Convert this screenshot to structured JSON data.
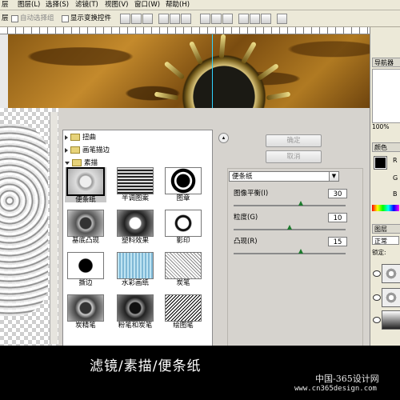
{
  "menu": [
    "层",
    "图层(L)",
    "选择(S)",
    "滤镜(T)",
    "视图(V)",
    "窗口(W)",
    "帮助(H)"
  ],
  "options": {
    "layer_label": "层",
    "auto_select_group": "自动选择组",
    "show_transform": "显示变换控件"
  },
  "panels": {
    "navigator_tab": "导航器",
    "zoom": "100%",
    "color_tab": "颜色",
    "color_channels": [
      "R",
      "G",
      "B"
    ],
    "layers_tab": "图层",
    "blend_mode": "正常",
    "lock_label": "锁定:"
  },
  "filter_gallery": {
    "categories": [
      {
        "label": "扭曲",
        "expanded": false
      },
      {
        "label": "画笔描边",
        "expanded": false
      },
      {
        "label": "素描",
        "expanded": true
      }
    ],
    "filters": [
      {
        "label": "便条纸",
        "selected": true
      },
      {
        "label": "半调图案"
      },
      {
        "label": "图章"
      },
      {
        "label": "基底凸现"
      },
      {
        "label": "塑料效果"
      },
      {
        "label": "影印"
      },
      {
        "label": "撕边"
      },
      {
        "label": "水彩画纸"
      },
      {
        "label": "炭笔"
      },
      {
        "label": "炭精笔"
      },
      {
        "label": "粉笔和炭笔"
      },
      {
        "label": "绘图笔"
      }
    ],
    "ok_label": "确定",
    "cancel_label": "取消",
    "current_filter": "便条纸",
    "params": [
      {
        "label": "图像平衡(I)",
        "value": "30",
        "fraction": 0.6
      },
      {
        "label": "粒度(G)",
        "value": "10",
        "fraction": 0.5
      },
      {
        "label": "凸现(R)",
        "value": "15",
        "fraction": 0.6
      }
    ]
  },
  "caption": "滤镜/素描/便条纸",
  "watermark": {
    "line1": "中国-365设计网",
    "line2": "www.cn365design.com"
  },
  "colors": {
    "selection_outline": "#000000",
    "slider_knob": "#1c7a2c",
    "guide": "#2fd2ff"
  }
}
